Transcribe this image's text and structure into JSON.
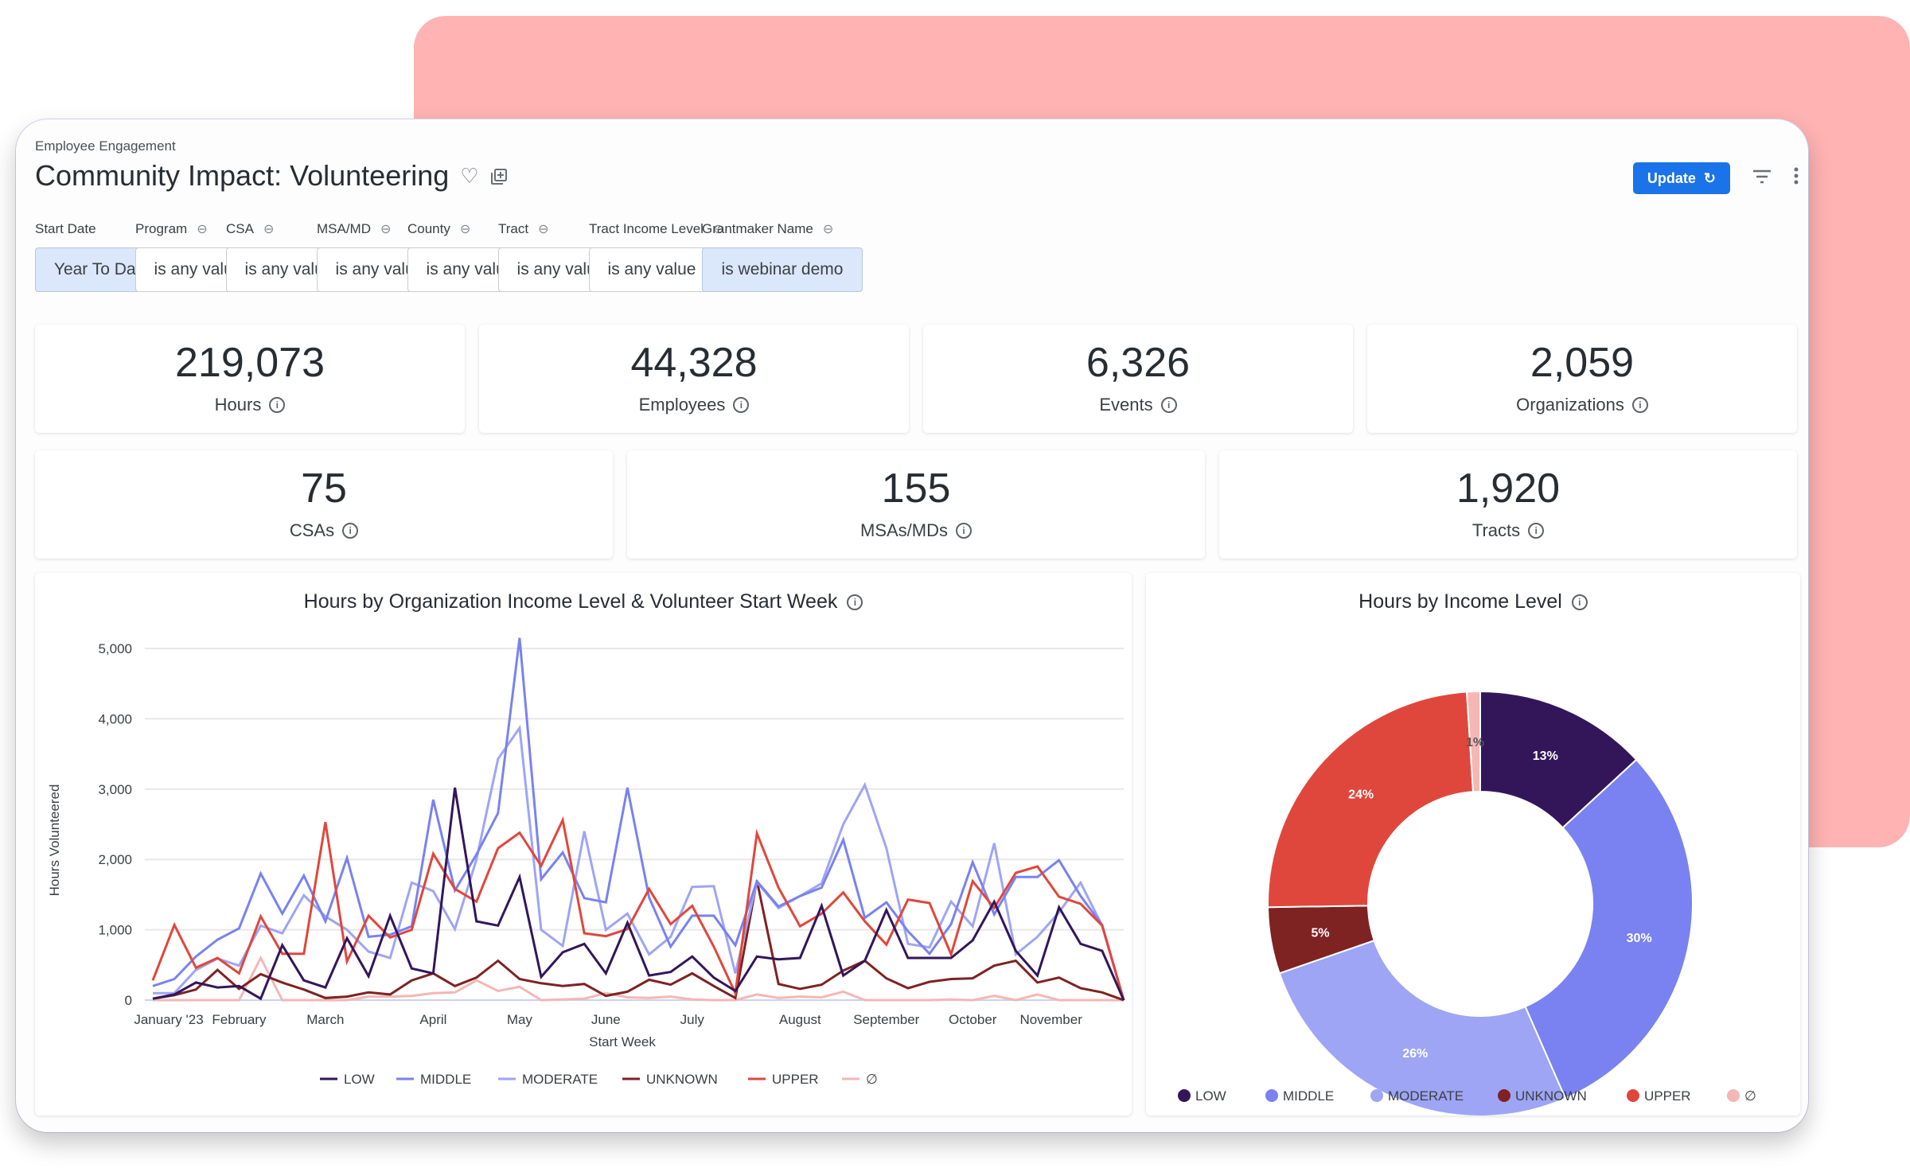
{
  "header": {
    "breadcrumb": "Employee Engagement",
    "title": "Community Impact: Volunteering",
    "favorite_icon": "heart-outline-icon",
    "copy_icon": "add-to-board-icon",
    "update_label": "Update",
    "update_icon": "refresh-icon",
    "filter_icon": "filter-icon",
    "more_icon": "more-vert-icon"
  },
  "filters": [
    {
      "label": "Start Date",
      "value": "Year To Date",
      "linked": false,
      "selected": true
    },
    {
      "label": "Program",
      "value": "is any value",
      "linked": true,
      "selected": false
    },
    {
      "label": "CSA",
      "value": "is any value",
      "linked": true,
      "selected": false
    },
    {
      "label": "MSA/MD",
      "value": "is any value",
      "linked": true,
      "selected": false
    },
    {
      "label": "County",
      "value": "is any value",
      "linked": true,
      "selected": false
    },
    {
      "label": "Tract",
      "value": "is any value",
      "linked": true,
      "selected": false
    },
    {
      "label": "Tract Income Level",
      "value": "is any value",
      "linked": true,
      "selected": false
    },
    {
      "label": "Grantmaker Name",
      "value": "is webinar demo",
      "linked": true,
      "selected": true
    }
  ],
  "kpis_row1": [
    {
      "value": "219,073",
      "label": "Hours"
    },
    {
      "value": "44,328",
      "label": "Employees"
    },
    {
      "value": "6,326",
      "label": "Events"
    },
    {
      "value": "2,059",
      "label": "Organizations"
    }
  ],
  "kpis_row2": [
    {
      "value": "75",
      "label": "CSAs"
    },
    {
      "value": "155",
      "label": "MSAs/MDs"
    },
    {
      "value": "1,920",
      "label": "Tracts"
    }
  ],
  "colors": {
    "LOW": "#33165a",
    "MIDDLE": "#7982f0",
    "MODERATE": "#9ea5f5",
    "UNKNOWN": "#7f2222",
    "UPPER": "#e0473c",
    "NULL": "#f4b7b4",
    "accent": "#1a73e8",
    "backdrop": "#ffb3b3"
  },
  "chart_data": [
    {
      "type": "line",
      "title": "Hours by Organization Income Level & Volunteer Start Week",
      "xlabel": "Start Week",
      "ylabel": "Hours Volunteered",
      "ylim": [
        0,
        5000
      ],
      "yticks": [
        0,
        1000,
        2000,
        3000,
        4000,
        5000
      ],
      "ytick_labels": [
        "0",
        "1,000",
        "2,000",
        "3,000",
        "4,000",
        "5,000"
      ],
      "x_month_labels": [
        {
          "label": "January '23",
          "week": 1
        },
        {
          "label": "February",
          "week": 5
        },
        {
          "label": "March",
          "week": 9
        },
        {
          "label": "April",
          "week": 14
        },
        {
          "label": "May",
          "week": 18
        },
        {
          "label": "June",
          "week": 22
        },
        {
          "label": "July",
          "week": 26
        },
        {
          "label": "August",
          "week": 31
        },
        {
          "label": "September",
          "week": 35
        },
        {
          "label": "October",
          "week": 39
        },
        {
          "label": "November",
          "week": 43
        }
      ],
      "grid": true,
      "legend": "bottom",
      "series": [
        {
          "name": "LOW",
          "values": [
            20,
            80,
            250,
            180,
            200,
            20,
            780,
            280,
            180,
            880,
            340,
            1200,
            450,
            380,
            3020,
            1120,
            1060,
            1750,
            330,
            680,
            800,
            380,
            1100,
            350,
            400,
            620,
            320,
            130,
            620,
            580,
            600,
            1340,
            350,
            560,
            1280,
            600,
            600,
            600,
            850,
            1400,
            700,
            350,
            1320,
            800,
            700,
            0
          ]
        },
        {
          "name": "MIDDLE",
          "values": [
            200,
            300,
            620,
            860,
            1020,
            1800,
            1230,
            1770,
            1120,
            2020,
            900,
            930,
            1050,
            2850,
            1560,
            2070,
            2660,
            5150,
            1720,
            2100,
            1450,
            1390,
            3020,
            1460,
            760,
            1200,
            1200,
            780,
            1690,
            1330,
            1480,
            1600,
            2280,
            1170,
            1390,
            980,
            660,
            1080,
            1960,
            1220,
            1750,
            1750,
            1990,
            1480,
            1070,
            0
          ]
        },
        {
          "name": "MODERATE",
          "values": [
            100,
            100,
            430,
            590,
            490,
            1060,
            950,
            1490,
            1190,
            1000,
            690,
            600,
            1670,
            1550,
            1010,
            2000,
            3430,
            3870,
            1000,
            770,
            2400,
            1000,
            1230,
            650,
            900,
            1610,
            1620,
            380,
            1680,
            1310,
            1480,
            1660,
            2500,
            3060,
            2160,
            800,
            750,
            1400,
            1050,
            2230,
            650,
            900,
            1250,
            1670,
            1060,
            0
          ]
        },
        {
          "name": "UNKNOWN",
          "values": [
            20,
            70,
            150,
            430,
            160,
            370,
            250,
            150,
            30,
            50,
            110,
            80,
            280,
            380,
            200,
            320,
            560,
            300,
            240,
            200,
            230,
            60,
            120,
            290,
            220,
            380,
            200,
            30,
            1700,
            230,
            160,
            220,
            420,
            560,
            310,
            170,
            260,
            300,
            310,
            490,
            560,
            250,
            320,
            170,
            110,
            0
          ]
        },
        {
          "name": "UPPER",
          "values": [
            280,
            1070,
            460,
            600,
            380,
            1190,
            660,
            660,
            2530,
            550,
            1200,
            890,
            1000,
            2080,
            1580,
            1400,
            2160,
            2380,
            1910,
            2560,
            950,
            910,
            1010,
            1580,
            1080,
            1340,
            760,
            100,
            2370,
            1600,
            1050,
            1230,
            1530,
            1120,
            790,
            1430,
            1380,
            650,
            1690,
            1310,
            1810,
            1900,
            1470,
            1370,
            1060,
            0
          ]
        },
        {
          "name": "∅",
          "values": [
            0,
            0,
            0,
            0,
            0,
            600,
            0,
            0,
            0,
            0,
            50,
            50,
            60,
            100,
            110,
            280,
            130,
            190,
            0,
            10,
            20,
            100,
            40,
            30,
            50,
            10,
            0,
            0,
            80,
            30,
            50,
            40,
            120,
            0,
            0,
            0,
            0,
            10,
            0,
            60,
            0,
            80,
            0,
            0,
            0,
            0
          ]
        }
      ]
    },
    {
      "type": "pie",
      "donut": true,
      "title": "Hours by Income Level",
      "legend": "bottom",
      "categories": [
        "LOW",
        "MIDDLE",
        "MODERATE",
        "UNKNOWN",
        "UPPER",
        "∅"
      ],
      "values": [
        13,
        30,
        26,
        5,
        24,
        1
      ],
      "labels": [
        "13%",
        "30%",
        "26%",
        "5%",
        "24%",
        "1%"
      ],
      "unit": "percent"
    }
  ]
}
